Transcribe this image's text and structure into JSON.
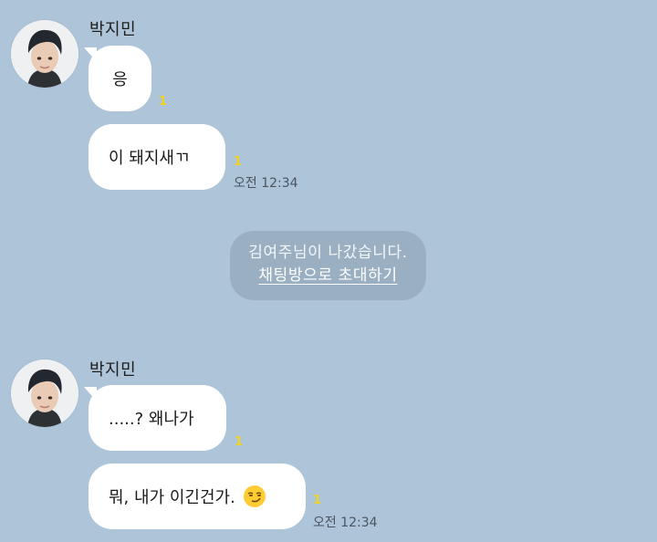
{
  "colors": {
    "background": "#adc4d9",
    "bubble": "#ffffff",
    "notice_bg": "#9aafc2",
    "unread": "#f2d31b"
  },
  "groups": [
    {
      "sender": "박지민",
      "messages": [
        {
          "text": "응",
          "unread": "1",
          "time": ""
        },
        {
          "text": "이 돼지새ㄲ",
          "unread": "1",
          "time": "오전 12:34"
        }
      ]
    },
    {
      "sender": "박지민",
      "messages": [
        {
          "text": ".....? 왜나가",
          "unread": "1",
          "time": ""
        },
        {
          "text": "뭐, 내가 이긴건가.",
          "unread": "1",
          "time": "오전 12:34",
          "emoji": "smirk-emoji"
        }
      ]
    }
  ],
  "notice": {
    "text": "김여주님이 나갔습니다.",
    "link": "채팅방으로 초대하기"
  }
}
